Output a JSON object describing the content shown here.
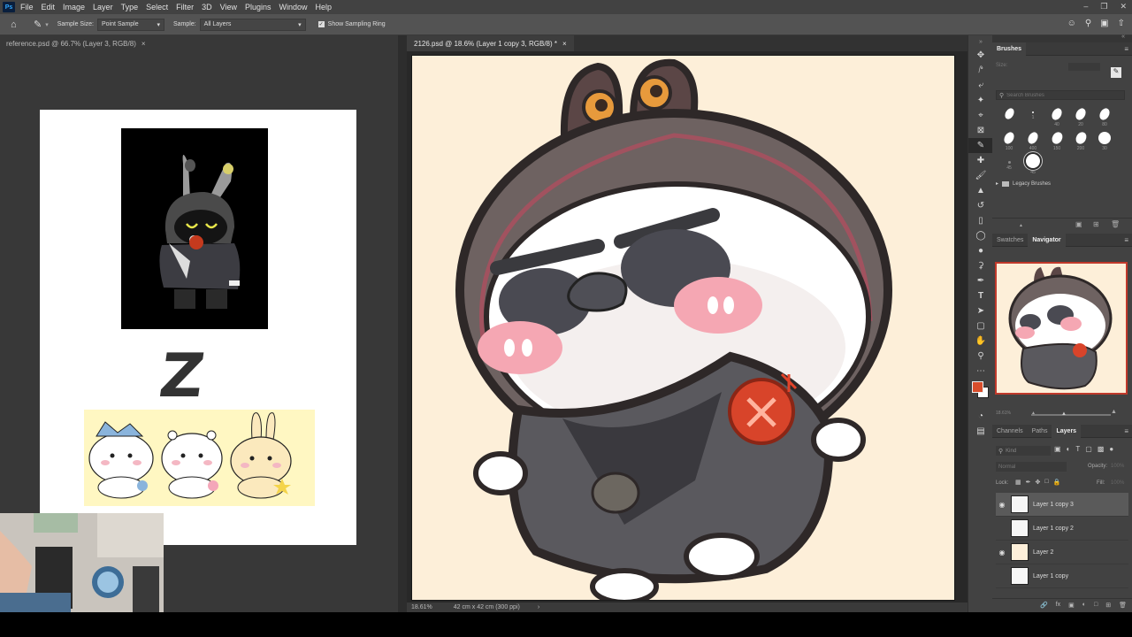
{
  "menu": {
    "app_logo": "Ps",
    "items": [
      "File",
      "Edit",
      "Image",
      "Layer",
      "Type",
      "Select",
      "Filter",
      "3D",
      "View",
      "Plugins",
      "Window",
      "Help"
    ]
  },
  "options": {
    "sample_size_label": "Sample Size:",
    "sample_size_value": "Point Sample",
    "sample_label": "Sample:",
    "sample_value": "All Layers",
    "show_ring_label": "Show Sampling Ring"
  },
  "left_doc": {
    "tab_title": "reference.psd @ 66.7% (Layer 3, RGB/8)",
    "close": "×",
    "z_letter": "Z"
  },
  "main_doc": {
    "tab_title": "2126.psd @ 18.6% (Layer 1 copy 3, RGB/8) *",
    "close": "×",
    "zoom": "18.61%",
    "doc_size": "42 cm x 42 cm (300 ppi)",
    "status_arrow": "›"
  },
  "brushes_panel": {
    "tab": "Brushes",
    "size_label": "Size:",
    "search_placeholder": "Search Brushes",
    "presets": [
      {
        "size": ""
      },
      {
        "size": "1"
      },
      {
        "size": "40"
      },
      {
        "size": "20"
      },
      {
        "size": "80"
      },
      {
        "size": "100"
      },
      {
        "size": "400"
      },
      {
        "size": "150"
      },
      {
        "size": "200"
      },
      {
        "size": "30"
      },
      {
        "size": "45"
      },
      {
        "size": "45"
      }
    ],
    "folder": "Legacy Brushes"
  },
  "navigator_panel": {
    "tabs": [
      "Swatches",
      "Navigator"
    ],
    "zoom": "18.61%"
  },
  "layers_panel": {
    "tabs": [
      "Channels",
      "Paths",
      "Layers"
    ],
    "kind_placeholder": "Kind",
    "blend_mode": "Normal",
    "opacity_label": "Opacity:",
    "opacity_value": "100%",
    "lock_label": "Lock:",
    "fill_label": "Fill:",
    "fill_value": "100%",
    "layers": [
      {
        "name": "Layer 1 copy 3",
        "visible": true,
        "selected": true
      },
      {
        "name": "Layer 1 copy 2",
        "visible": false,
        "selected": false
      },
      {
        "name": "Layer 2",
        "visible": true,
        "selected": false
      },
      {
        "name": "Layer 1 copy",
        "visible": false,
        "selected": false
      }
    ],
    "bottom_fx": "fx"
  },
  "colors": {
    "foreground": "#d84d2b",
    "background": "#ffffff",
    "canvas_bg": "#fdefd9"
  }
}
